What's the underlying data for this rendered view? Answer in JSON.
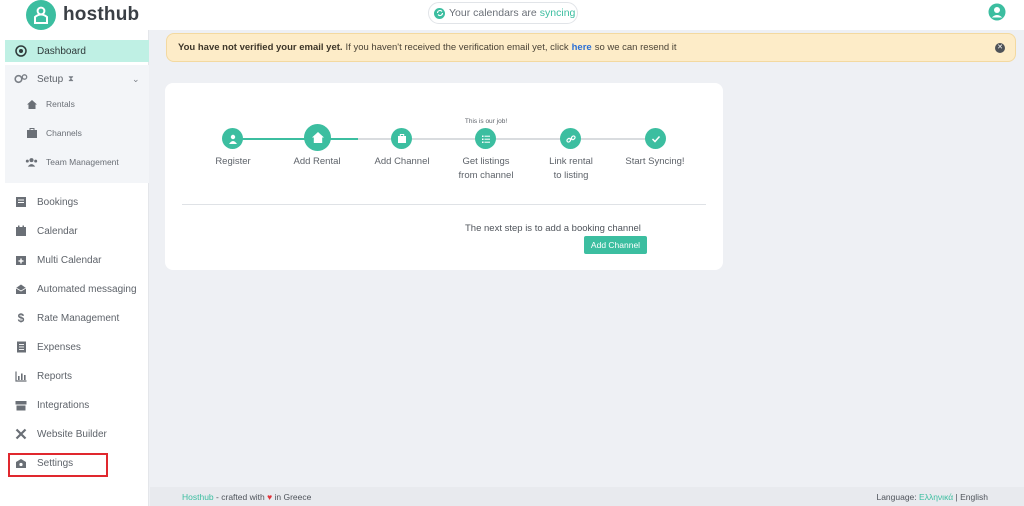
{
  "brand": {
    "name": "hosthub",
    "color": "#3cbea0"
  },
  "sync_status": {
    "prefix": "Your calendars are",
    "state": "syncing"
  },
  "sidebar": {
    "dashboard": "Dashboard",
    "setup": "Setup",
    "setup_sub": [
      "Rentals",
      "Channels",
      "Team Management"
    ],
    "items": [
      "Bookings",
      "Calendar",
      "Multi Calendar",
      "Automated messaging",
      "Rate Management",
      "Expenses",
      "Reports",
      "Integrations",
      "Website Builder",
      "Settings"
    ]
  },
  "alert": {
    "bold": "You have not verified your email yet.",
    "text": "If you haven't received the verification email yet, click",
    "link": "here",
    "suffix": "so we can resend it"
  },
  "onboarding": {
    "job_note": "This is our job!",
    "steps": [
      {
        "line1": "Register",
        "line2": ""
      },
      {
        "line1": "Add Rental",
        "line2": ""
      },
      {
        "line1": "Add Channel",
        "line2": ""
      },
      {
        "line1": "Get listings",
        "line2": "from channel"
      },
      {
        "line1": "Link rental",
        "line2": "to listing"
      },
      {
        "line1": "Start Syncing!",
        "line2": ""
      }
    ],
    "completed_steps": 2,
    "next_step_text": "The next step is to add a booking channel",
    "button_label": "Add Channel"
  },
  "footer": {
    "brand": "Hosthub",
    "crafted": "- crafted with",
    "location": "in Greece",
    "language_label": "Language:",
    "lang_greek": "Ελληνικά",
    "separator": "|",
    "lang_english": "English"
  },
  "icons": {
    "logo": "house-person-icon",
    "sync": "refresh-icon",
    "user": "user-circle-icon"
  }
}
